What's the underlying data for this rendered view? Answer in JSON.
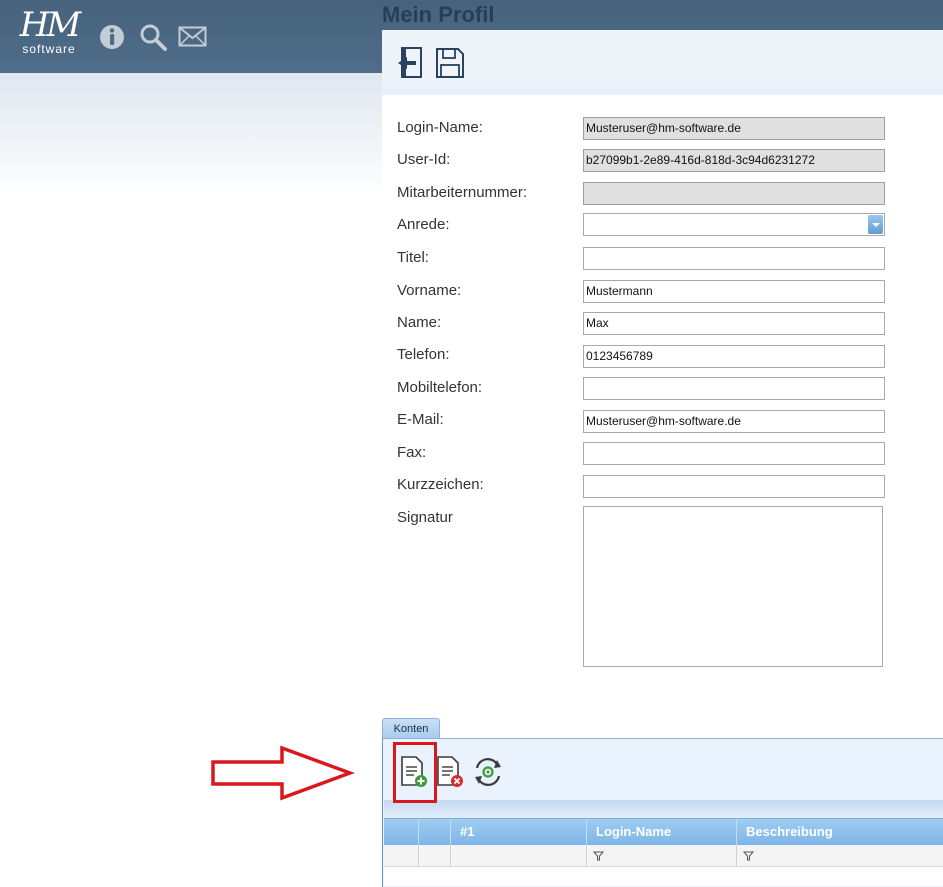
{
  "header": {
    "logo_mark": "HM",
    "logo_sub": "software",
    "icons": [
      "info-icon",
      "search-icon",
      "mail-icon"
    ]
  },
  "page": {
    "title": "Mein Profil",
    "toolbar": [
      "back-icon",
      "save-icon"
    ]
  },
  "form": {
    "fields": [
      {
        "label": "Login-Name:",
        "value": "Musteruser@hm-software.de",
        "readonly": true
      },
      {
        "label": "User-Id:",
        "value": "b27099b1-2e89-416d-818d-3c94d6231272",
        "readonly": true
      },
      {
        "label": "Mitarbeiternummer:",
        "value": "",
        "readonly": true
      },
      {
        "label": "Anrede:",
        "value": "",
        "type": "select"
      },
      {
        "label": "Titel:",
        "value": ""
      },
      {
        "label": "Vorname:",
        "value": "Mustermann"
      },
      {
        "label": "Name:",
        "value": "Max"
      },
      {
        "label": "Telefon:",
        "value": "0123456789"
      },
      {
        "label": "Mobiltelefon:",
        "value": ""
      },
      {
        "label": "E-Mail:",
        "value": "Musteruser@hm-software.de"
      },
      {
        "label": "Fax:",
        "value": ""
      },
      {
        "label": "Kurzzeichen:",
        "value": ""
      }
    ],
    "signatur_label": "Signatur",
    "signatur_value": ""
  },
  "konten": {
    "tab_label": "Konten",
    "toolbar": [
      "add-document-icon",
      "remove-document-icon",
      "refresh-icon"
    ],
    "columns": [
      "",
      "",
      "#1",
      "Login-Name",
      "Beschreibung"
    ]
  },
  "colors": {
    "header_bg": "#4e6d8a",
    "title": "#263f57",
    "grid_header": "#8ec1ec",
    "highlight": "#d7191c"
  }
}
